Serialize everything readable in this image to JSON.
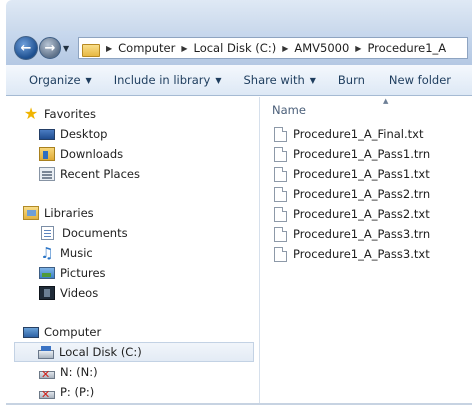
{
  "window": {
    "accent": "#1d4f8f"
  },
  "nav": {
    "back_icon": "back-arrow-icon",
    "forward_icon": "forward-arrow-icon"
  },
  "address": {
    "crumbs": [
      "Computer",
      "Local Disk (C:)",
      "AMV5000",
      "Procedure1_A"
    ]
  },
  "toolbar": {
    "organize": "Organize",
    "include_in_library": "Include in library",
    "share_with": "Share with",
    "burn": "Burn",
    "new_folder": "New folder"
  },
  "sidebar": {
    "favorites": {
      "label": "Favorites",
      "items": [
        "Desktop",
        "Downloads",
        "Recent Places"
      ]
    },
    "libraries": {
      "label": "Libraries",
      "items": [
        "Documents",
        "Music",
        "Pictures",
        "Videos"
      ]
    },
    "computer": {
      "label": "Computer",
      "items": [
        "Local Disk (C:)",
        "N: (N:)",
        "P: (P:)"
      ],
      "selected": "Local Disk (C:)"
    }
  },
  "files": {
    "column_name": "Name",
    "items": [
      "Procedure1_A_Final.txt",
      "Procedure1_A_Pass1.trn",
      "Procedure1_A_Pass1.txt",
      "Procedure1_A_Pass2.trn",
      "Procedure1_A_Pass2.txt",
      "Procedure1_A_Pass3.trn",
      "Procedure1_A_Pass3.txt"
    ]
  }
}
